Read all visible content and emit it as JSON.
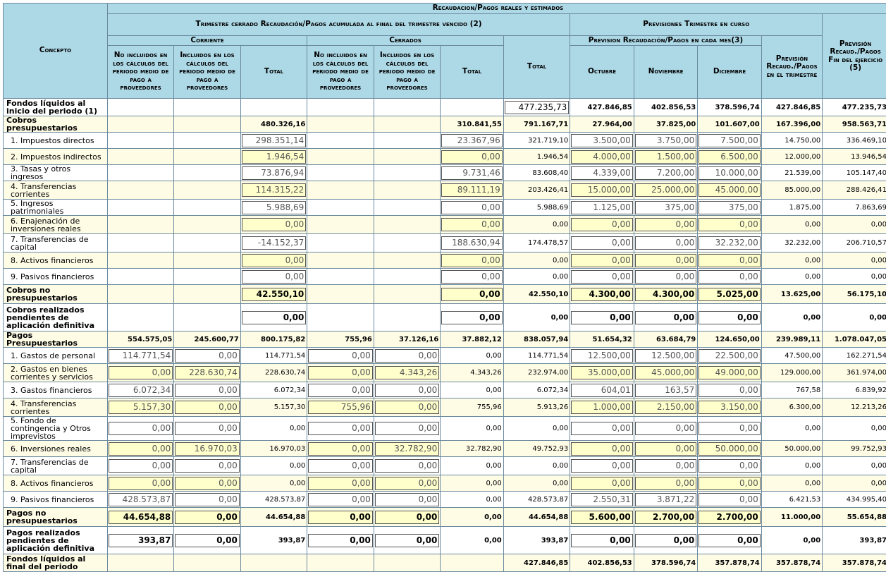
{
  "header": {
    "main": "Recaudacion/Pagos reales y estimados",
    "concepto": "Concepto",
    "trimestre": "Trimestre cerrado Recaudación/Pagos acumulada al final del trimestre vencido (2)",
    "previsiones": "Previsiones Trimestre en curso",
    "prevision_mes": "Prevision Recaudación/Pagos en cada mes(3)",
    "corriente": "Corriente",
    "cerrados": "Cerrados",
    "no_incluidos": "No incluidos en los cálculos del periodo medio de pago a proveedores",
    "incluidos": "Incluidos en los cálculos del periodo medio de pago a proveedores",
    "total": "Total",
    "total_big": "Total",
    "octubre": "Octubre",
    "noviembre": "Noviembre",
    "diciembre": "Diciembre",
    "prev_trimestre": "Previsión Recaud./Pagos en el trimestre",
    "prev_fin": "Previsión Recaud./Pagos Fin del ejercicio (5)"
  },
  "rows": [
    {
      "label": "Fondos líquidos al inicio del periodo (1)",
      "v": [
        "",
        "",
        "",
        "",
        "",
        "",
        "477.235,73",
        "427.846,85",
        "402.856,53",
        "378.596,74",
        "427.846,85",
        "477.235,73"
      ]
    },
    {
      "label": "Cobros presupuestarios",
      "v": [
        "",
        "",
        "480.326,16",
        "",
        "",
        "310.841,55",
        "791.167,71",
        "27.964,00",
        "37.825,00",
        "101.607,00",
        "167.396,00",
        "958.563,71"
      ]
    },
    {
      "label": "1. Impuestos directos",
      "v": [
        "",
        "",
        "298.351,14",
        "",
        "",
        "23.367,96",
        "321.719,10",
        "3.500,00",
        "3.750,00",
        "7.500,00",
        "14.750,00",
        "336.469,10"
      ]
    },
    {
      "label": "2. Impuestos indirectos",
      "v": [
        "",
        "",
        "1.946,54",
        "",
        "",
        "0,00",
        "1.946,54",
        "4.000,00",
        "1.500,00",
        "6.500,00",
        "12.000,00",
        "13.946,54"
      ]
    },
    {
      "label": "3. Tasas y otros ingresos",
      "v": [
        "",
        "",
        "73.876,94",
        "",
        "",
        "9.731,46",
        "83.608,40",
        "4.339,00",
        "7.200,00",
        "10.000,00",
        "21.539,00",
        "105.147,40"
      ]
    },
    {
      "label": "4. Transferencias corrientes",
      "v": [
        "",
        "",
        "114.315,22",
        "",
        "",
        "89.111,19",
        "203.426,41",
        "15.000,00",
        "25.000,00",
        "45.000,00",
        "85.000,00",
        "288.426,41"
      ]
    },
    {
      "label": "5. Ingresos patrimoniales",
      "v": [
        "",
        "",
        "5.988,69",
        "",
        "",
        "0,00",
        "5.988,69",
        "1.125,00",
        "375,00",
        "375,00",
        "1.875,00",
        "7.863,69"
      ]
    },
    {
      "label": "6. Enajenación de inversiones reales",
      "v": [
        "",
        "",
        "0,00",
        "",
        "",
        "0,00",
        "0,00",
        "0,00",
        "0,00",
        "0,00",
        "0,00",
        "0,00"
      ]
    },
    {
      "label": "7. Transferencias de capital",
      "v": [
        "",
        "",
        "-14.152,37",
        "",
        "",
        "188.630,94",
        "174.478,57",
        "0,00",
        "0,00",
        "32.232,00",
        "32.232,00",
        "206.710,57"
      ]
    },
    {
      "label": "8. Activos financieros",
      "v": [
        "",
        "",
        "0,00",
        "",
        "",
        "0,00",
        "0,00",
        "0,00",
        "0,00",
        "0,00",
        "0,00",
        "0,00"
      ]
    },
    {
      "label": "9. Pasivos financieros",
      "v": [
        "",
        "",
        "0,00",
        "",
        "",
        "0,00",
        "0,00",
        "0,00",
        "0,00",
        "0,00",
        "0,00",
        "0,00"
      ]
    },
    {
      "label": "Cobros no presupuestarios",
      "v": [
        "",
        "",
        "42.550,10",
        "",
        "",
        "0,00",
        "42.550,10",
        "4.300,00",
        "4.300,00",
        "5.025,00",
        "13.625,00",
        "56.175,10"
      ]
    },
    {
      "label": "Cobros realizados pendientes de aplicación definitiva",
      "v": [
        "",
        "",
        "0,00",
        "",
        "",
        "0,00",
        "0,00",
        "0,00",
        "0,00",
        "0,00",
        "0,00",
        "0,00"
      ]
    },
    {
      "label": "Pagos Presupuestarios",
      "v": [
        "554.575,05",
        "245.600,77",
        "800.175,82",
        "755,96",
        "37.126,16",
        "37.882,12",
        "838.057,94",
        "51.654,32",
        "63.684,79",
        "124.650,00",
        "239.989,11",
        "1.078.047,05"
      ]
    },
    {
      "label": "1. Gastos de personal",
      "v": [
        "114.771,54",
        "0,00",
        "114.771,54",
        "0,00",
        "0,00",
        "0,00",
        "114.771,54",
        "12.500,00",
        "12.500,00",
        "22.500,00",
        "47.500,00",
        "162.271,54"
      ]
    },
    {
      "label": "2. Gastos en bienes corrientes y servicios",
      "v": [
        "0,00",
        "228.630,74",
        "228.630,74",
        "0,00",
        "4.343,26",
        "4.343,26",
        "232.974,00",
        "35.000,00",
        "45.000,00",
        "49.000,00",
        "129.000,00",
        "361.974,00"
      ]
    },
    {
      "label": "3. Gastos financieros",
      "v": [
        "6.072,34",
        "0,00",
        "6.072,34",
        "0,00",
        "0,00",
        "0,00",
        "6.072,34",
        "604,01",
        "163,57",
        "0,00",
        "767,58",
        "6.839,92"
      ]
    },
    {
      "label": "4. Transferencias corrientes",
      "v": [
        "5.157,30",
        "0,00",
        "5.157,30",
        "755,96",
        "0,00",
        "755,96",
        "5.913,26",
        "1.000,00",
        "2.150,00",
        "3.150,00",
        "6.300,00",
        "12.213,26"
      ]
    },
    {
      "label": "5. Fondo de contingencia y Otros imprevistos",
      "v": [
        "0,00",
        "0,00",
        "0,00",
        "0,00",
        "0,00",
        "0,00",
        "0,00",
        "0,00",
        "0,00",
        "0,00",
        "0,00",
        "0,00"
      ]
    },
    {
      "label": "6. Inversiones reales",
      "v": [
        "0,00",
        "16.970,03",
        "16.970,03",
        "0,00",
        "32.782,90",
        "32.782,90",
        "49.752,93",
        "0,00",
        "0,00",
        "50.000,00",
        "50.000,00",
        "99.752,93"
      ]
    },
    {
      "label": "7. Transferencias de capital",
      "v": [
        "0,00",
        "0,00",
        "0,00",
        "0,00",
        "0,00",
        "0,00",
        "0,00",
        "0,00",
        "0,00",
        "0,00",
        "0,00",
        "0,00"
      ]
    },
    {
      "label": "8. Activos financieros",
      "v": [
        "0,00",
        "0,00",
        "0,00",
        "0,00",
        "0,00",
        "0,00",
        "0,00",
        "0,00",
        "0,00",
        "0,00",
        "0,00",
        "0,00"
      ]
    },
    {
      "label": "9. Pasivos financieros",
      "v": [
        "428.573,87",
        "0,00",
        "428.573,87",
        "0,00",
        "0,00",
        "0,00",
        "428.573,87",
        "2.550,31",
        "3.871,22",
        "0,00",
        "6.421,53",
        "434.995,40"
      ]
    },
    {
      "label": "Pagos no presupuestarios",
      "v": [
        "44.654,88",
        "0,00",
        "44.654,88",
        "0,00",
        "0,00",
        "0,00",
        "44.654,88",
        "5.600,00",
        "2.700,00",
        "2.700,00",
        "11.000,00",
        "55.654,88"
      ]
    },
    {
      "label": "Pagos realizados pendientes de aplicación definitiva",
      "v": [
        "393,87",
        "0,00",
        "393,87",
        "0,00",
        "0,00",
        "0,00",
        "393,87",
        "0,00",
        "0,00",
        "0,00",
        "0,00",
        "393,87"
      ]
    },
    {
      "label": "Fondos líquidos al final del periodo",
      "v": [
        "",
        "",
        "",
        "",
        "",
        "",
        "427.846,85",
        "402.856,53",
        "378.596,74",
        "357.878,74",
        "357.878,74",
        "357.878,74"
      ]
    }
  ]
}
